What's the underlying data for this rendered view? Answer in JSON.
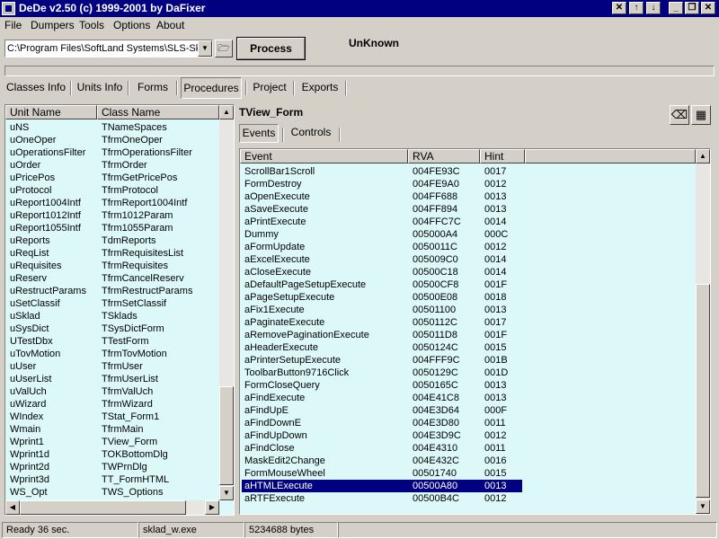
{
  "window": {
    "title": "DeDe v2.50 (c) 1999-2001 by DaFixer"
  },
  "menu": [
    "File",
    "Dumpers",
    "Tools",
    "Options",
    "About"
  ],
  "toolbar": {
    "path_value": "C:\\Program Files\\SoftLand Systems\\SLS-Skl",
    "process_label": "Process",
    "compiler_status": "UnKnown"
  },
  "tabs": [
    "Classes Info",
    "Units Info",
    "Forms",
    "Procedures",
    "Project",
    "Exports"
  ],
  "active_tab": "Procedures",
  "units": {
    "headers": [
      "Unit Name",
      "Class Name"
    ],
    "rows": [
      [
        "uNS",
        "TNameSpaces"
      ],
      [
        "uOneOper",
        "TfrmOneOper"
      ],
      [
        "uOperationsFilter",
        "TfrmOperationsFilter"
      ],
      [
        "uOrder",
        "TfrmOrder"
      ],
      [
        "uPricePos",
        "TfrmGetPricePos"
      ],
      [
        "uProtocol",
        "TfrmProtocol"
      ],
      [
        "uReport1004Intf",
        "TfrmReport1004Intf"
      ],
      [
        "uReport1012Intf",
        "Tfrm1012Param"
      ],
      [
        "uReport1055Intf",
        "Tfrm1055Param"
      ],
      [
        "uReports",
        "TdmReports"
      ],
      [
        "uReqList",
        "TfrmRequisitesList"
      ],
      [
        "uRequisites",
        "TfrmRequisites"
      ],
      [
        "uReserv",
        "TfrmCancelReserv"
      ],
      [
        "uRestructParams",
        "TfrmRestructParams"
      ],
      [
        "uSetClassif",
        "TfrmSetClassif"
      ],
      [
        "uSklad",
        "TSklads"
      ],
      [
        "uSysDict",
        "TSysDictForm"
      ],
      [
        "UTestDbx",
        "TTestForm"
      ],
      [
        "uTovMotion",
        "TfrmTovMotion"
      ],
      [
        "uUser",
        "TfrmUser"
      ],
      [
        "uUserList",
        "TfrmUserList"
      ],
      [
        "uValUch",
        "TfrmValUch"
      ],
      [
        "uWizard",
        "TfrmWizard"
      ],
      [
        "WIndex",
        "TStat_Form1"
      ],
      [
        "Wmain",
        "TfrmMain"
      ],
      [
        "Wprint1",
        "TView_Form"
      ],
      [
        "Wprint1d",
        "TOKBottomDlg"
      ],
      [
        "Wprint2d",
        "TWPrnDlg"
      ],
      [
        "Wprint3d",
        "TT_FormHTML"
      ],
      [
        "WS_Opt",
        "TWS_Options"
      ]
    ]
  },
  "form": {
    "title": "TView_Form",
    "subtabs": [
      "Events",
      "Controls"
    ],
    "active_subtab": "Events",
    "headers": [
      "Event",
      "RVA",
      "Hint"
    ],
    "rows": [
      [
        "ScrollBar1Scroll",
        "004FE93C",
        "0017"
      ],
      [
        "FormDestroy",
        "004FE9A0",
        "0012"
      ],
      [
        "aOpenExecute",
        "004FF688",
        "0013"
      ],
      [
        "aSaveExecute",
        "004FF894",
        "0013"
      ],
      [
        "aPrintExecute",
        "004FFC7C",
        "0014"
      ],
      [
        "Dummy",
        "005000A4",
        "000C"
      ],
      [
        "aFormUpdate",
        "0050011C",
        "0012"
      ],
      [
        "aExcelExecute",
        "005009C0",
        "0014"
      ],
      [
        "aCloseExecute",
        "00500C18",
        "0014"
      ],
      [
        "aDefaultPageSetupExecute",
        "00500CF8",
        "001F"
      ],
      [
        "aPageSetupExecute",
        "00500E08",
        "0018"
      ],
      [
        "aFix1Execute",
        "00501100",
        "0013"
      ],
      [
        "aPaginateExecute",
        "0050112C",
        "0017"
      ],
      [
        "aRemovePaginationExecute",
        "005011D8",
        "001F"
      ],
      [
        "aHeaderExecute",
        "0050124C",
        "0015"
      ],
      [
        "aPrinterSetupExecute",
        "004FFF9C",
        "001B"
      ],
      [
        "ToolbarButton9716Click",
        "0050129C",
        "001D"
      ],
      [
        "FormCloseQuery",
        "0050165C",
        "0013"
      ],
      [
        "aFindExecute",
        "004E41C8",
        "0013"
      ],
      [
        "aFindUpE",
        "004E3D64",
        "000F"
      ],
      [
        "aFindDownE",
        "004E3D80",
        "0011"
      ],
      [
        "aFindUpDown",
        "004E3D9C",
        "0012"
      ],
      [
        "aFindClose",
        "004E4310",
        "0011"
      ],
      [
        "MaskEdit2Change",
        "004E432C",
        "0016"
      ],
      [
        "FormMouseWheel",
        "00501740",
        "0015"
      ],
      [
        "aHTMLExecute",
        "00500A80",
        "0013"
      ],
      [
        "aRTFExecute",
        "00500B4C",
        "0012"
      ]
    ],
    "selected_row": 25
  },
  "status": {
    "ready": "Ready 36 sec.",
    "file": "sklad_w.exe",
    "size": "5234688 bytes"
  },
  "colors": {
    "title_bar": "#000080",
    "list_bg": "#dcf8f8",
    "face": "#d4d0c8",
    "selection": "#000080"
  }
}
